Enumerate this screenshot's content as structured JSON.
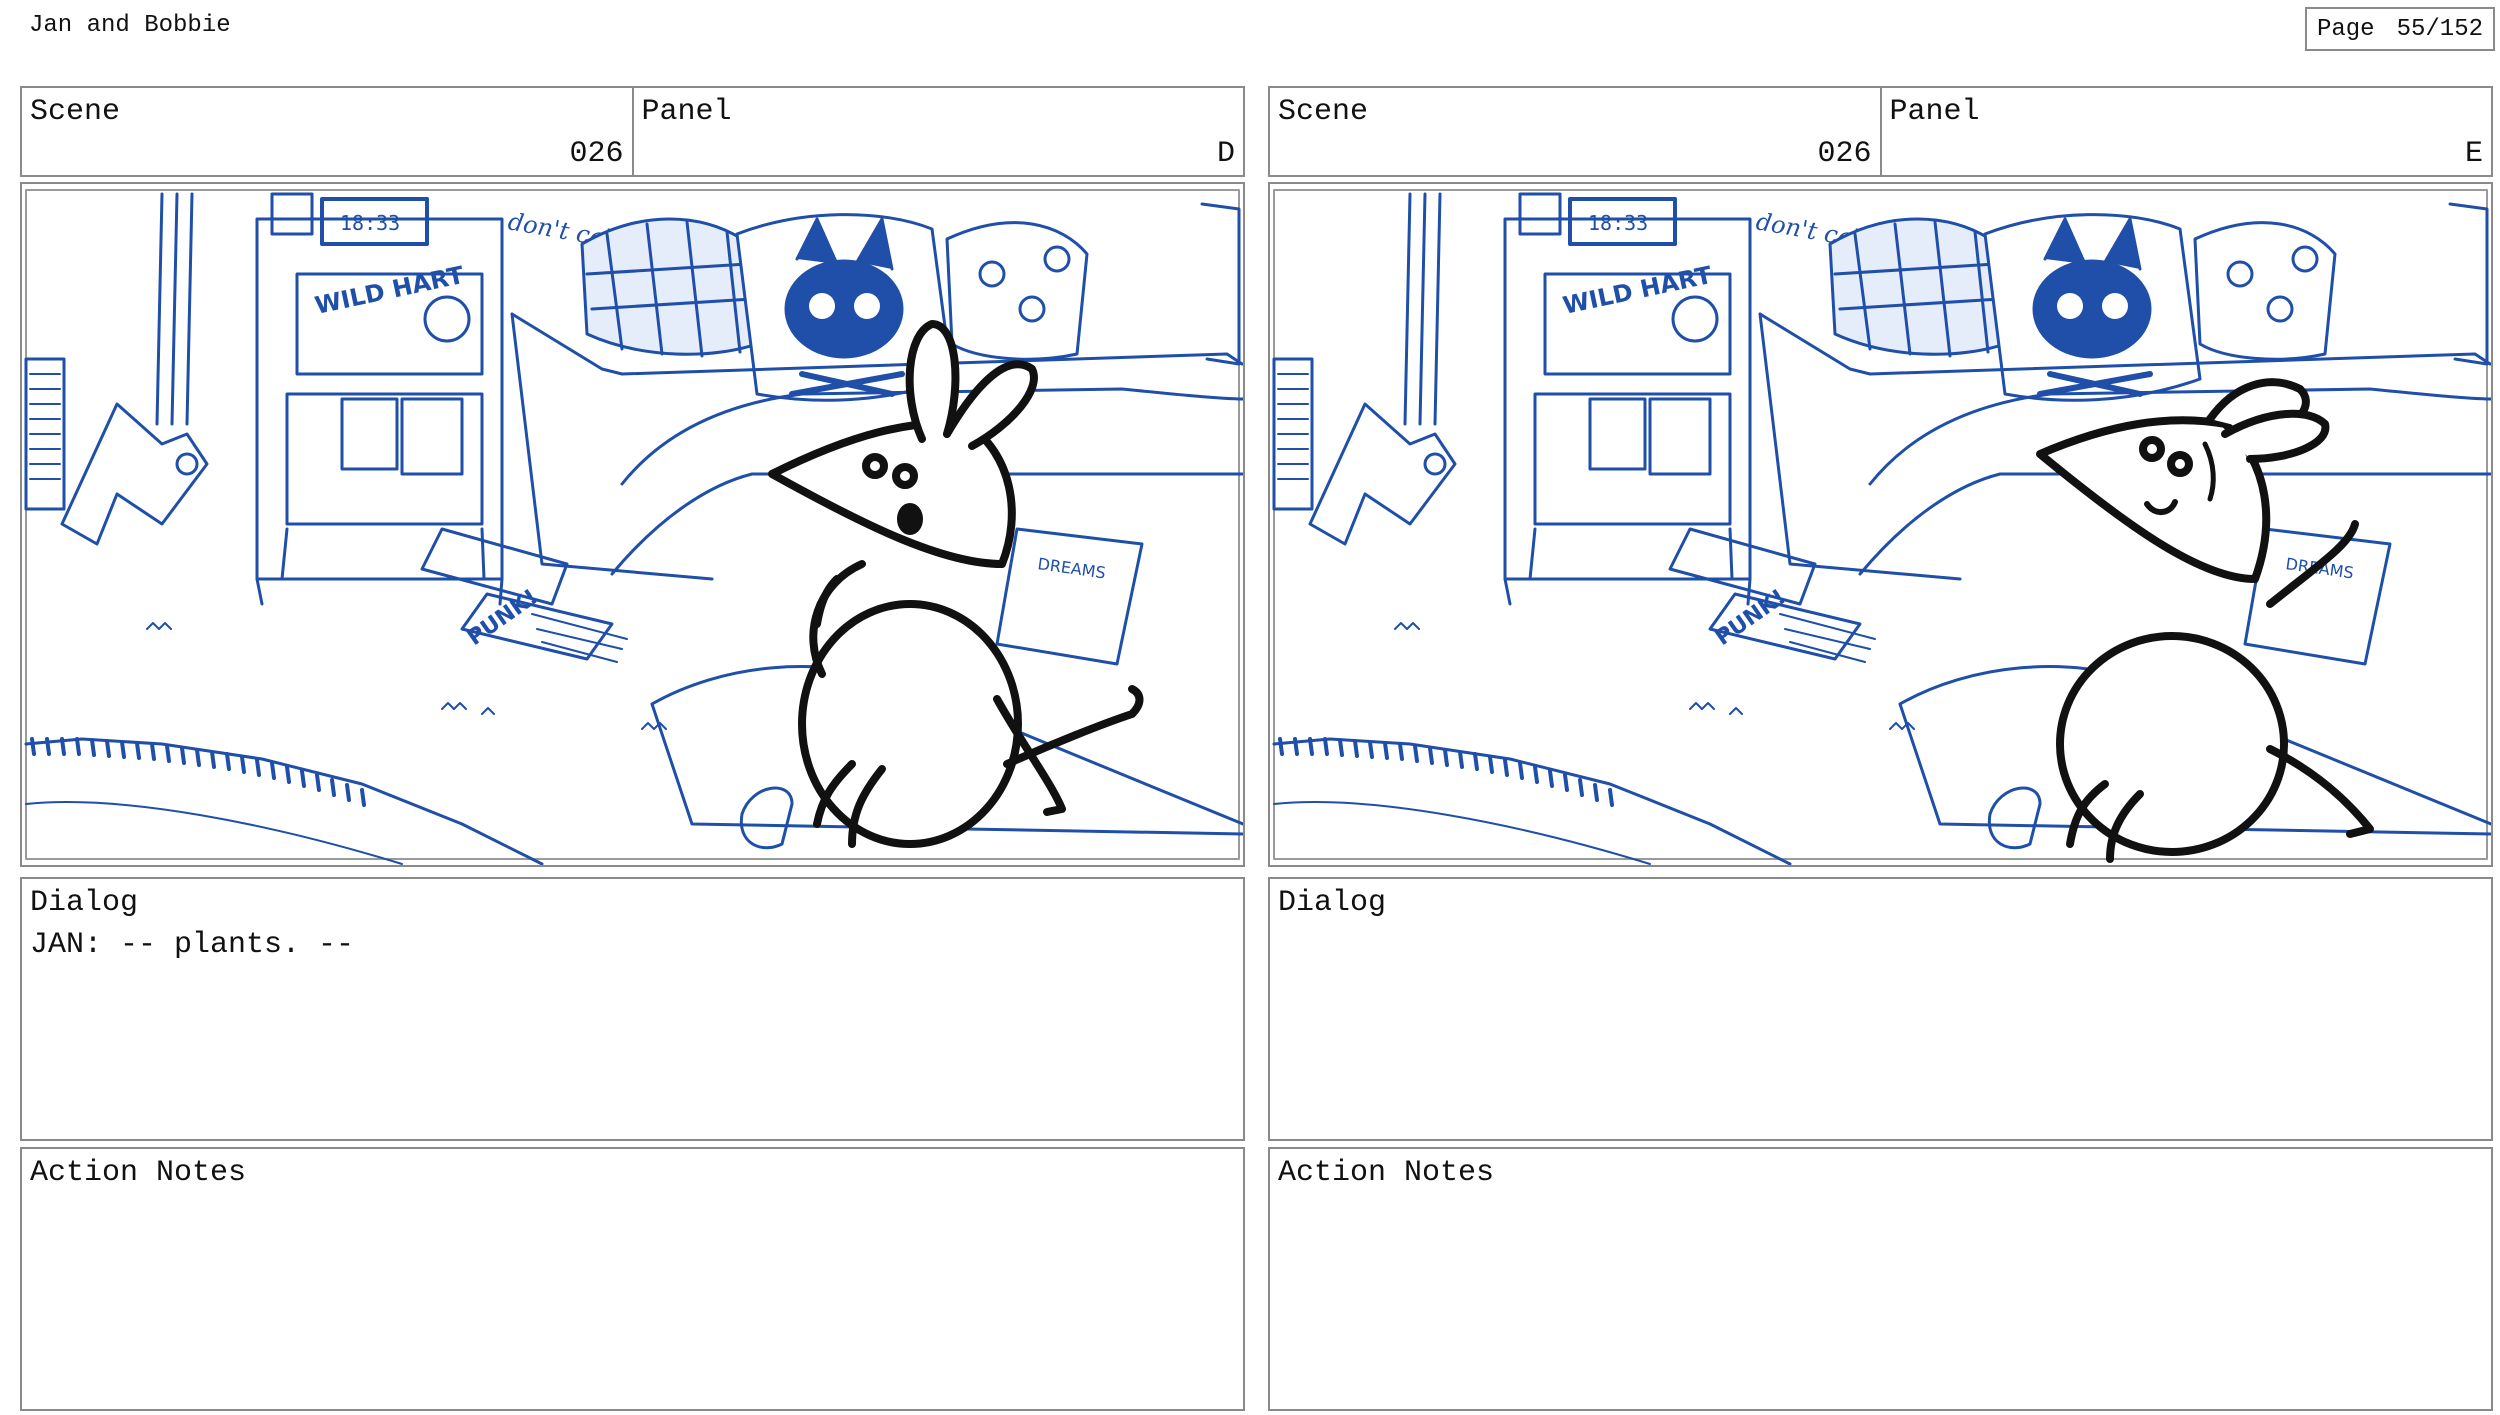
{
  "document": {
    "title": "Jan and Bobbie",
    "page_label": "Page",
    "page_number": "55/152"
  },
  "panels": [
    {
      "scene_label": "Scene",
      "scene": "026",
      "panel_label": "Panel",
      "panel": "D",
      "dialog_label": "Dialog",
      "dialog": "JAN: -- plants. --",
      "notes_label": "Action Notes",
      "notes": ""
    },
    {
      "scene_label": "Scene",
      "scene": "026",
      "panel_label": "Panel",
      "panel": "E",
      "dialog_label": "Dialog",
      "dialog": "",
      "notes_label": "Action Notes",
      "notes": ""
    }
  ],
  "artwork": {
    "clock_text": "18:33",
    "sticker_text": "WILD HART",
    "poster_text": "don't call me sweet",
    "magazine_text": "PUNK!",
    "book_text": "DREAMS",
    "line_color": "#1f4fa8",
    "character_color": "#111111"
  }
}
